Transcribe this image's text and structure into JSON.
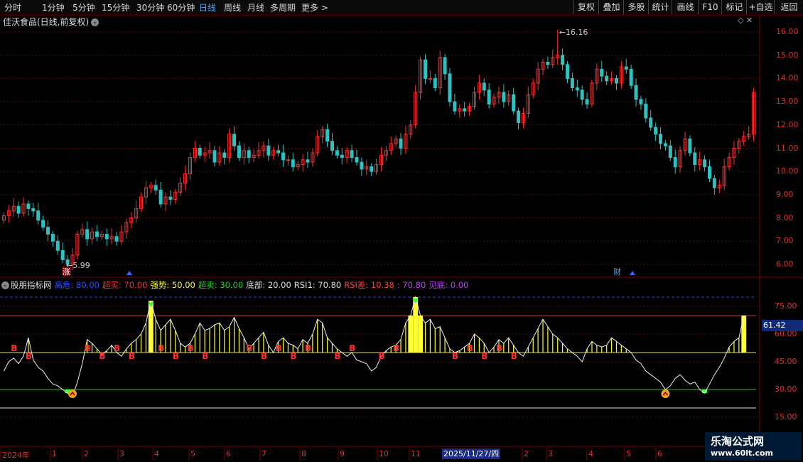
{
  "topbar": {
    "periods": [
      "分时",
      "1分钟",
      "5分钟",
      "15分钟",
      "30分钟",
      "60分钟",
      "日线",
      "周线",
      "月线",
      "多周期",
      "更多 >"
    ],
    "active_period": "日线",
    "buttons": [
      "复权",
      "叠加",
      "多股",
      "统计",
      "画线",
      "F10",
      "标记",
      "+自选",
      "返回"
    ]
  },
  "main_chart": {
    "title": "佳沃食品(日线,前复权)",
    "high_marker": "16.16",
    "low_marker": "5.99",
    "y_ticks": [
      "16.00",
      "15.00",
      "14.00",
      "13.00",
      "12.00",
      "11.00",
      "10.00",
      "9.00",
      "8.00",
      "7.00",
      "6.00"
    ],
    "event_tags": [
      "涨",
      "财"
    ]
  },
  "indicator": {
    "name": "股朋指标网",
    "params": [
      {
        "label": "高危:",
        "value": "80.00",
        "color": "#3050ff"
      },
      {
        "label": "超买:",
        "value": "70.00",
        "color": "#ff3030"
      },
      {
        "label": "强势:",
        "value": "50.00",
        "color": "#ffff40"
      },
      {
        "label": "超卖:",
        "value": "30.00",
        "color": "#30d030"
      },
      {
        "label": "底部:",
        "value": "20.00",
        "color": "#e0e0e0"
      },
      {
        "label": "RSI1:",
        "value": "70.80",
        "color": "#e0e0e0"
      },
      {
        "label": "RSI差:",
        "value": "10.38",
        "color": "#ff4040"
      },
      {
        "label": ":",
        "value": "70.80",
        "color": "#c040ff"
      },
      {
        "label": "见底:",
        "value": "0.00",
        "color": "#c040ff"
      }
    ],
    "y_ticks": [
      "75.00",
      "60.00",
      "45.00",
      "30.00",
      "15.00"
    ],
    "current_value": "61.42"
  },
  "date_axis": {
    "labels": [
      "2024年",
      "1",
      "2",
      "3",
      "4",
      "5",
      "6",
      "7",
      "8",
      "9",
      "10",
      "11",
      "2",
      "3",
      "4",
      "5",
      "6"
    ],
    "cursor_date": "2025/11/27/四"
  },
  "watermark": {
    "line1": "乐淘公式网",
    "line2": "www.60lt.com"
  },
  "chart_data": {
    "type": "candlestick",
    "y_range": [
      5.6,
      16.5
    ],
    "close": [
      8.1,
      8.3,
      8.5,
      8.2,
      8.6,
      8.4,
      8.3,
      7.9,
      7.6,
      7.3,
      7.0,
      6.6,
      6.2,
      6.0,
      6.4,
      7.3,
      7.5,
      7.1,
      7.4,
      7.2,
      7.3,
      7.1,
      7.2,
      7.0,
      7.4,
      7.8,
      8.0,
      8.4,
      8.9,
      9.3,
      9.4,
      9.2,
      8.6,
      8.9,
      8.8,
      9.1,
      9.5,
      9.9,
      10.6,
      11.0,
      10.7,
      10.8,
      10.9,
      10.4,
      10.8,
      10.6,
      11.6,
      11.1,
      10.6,
      10.9,
      10.6,
      10.7,
      10.9,
      11.1,
      10.7,
      10.9,
      10.8,
      10.5,
      10.5,
      10.2,
      10.3,
      10.5,
      10.4,
      10.8,
      11.5,
      11.8,
      11.3,
      10.9,
      10.7,
      10.6,
      10.9,
      10.6,
      10.4,
      10.1,
      10.2,
      10.0,
      10.3,
      10.7,
      10.9,
      11.2,
      11.4,
      11.0,
      11.6,
      12.0,
      13.4,
      14.8,
      14.0,
      14.0,
      13.6,
      14.9,
      14.2,
      13.0,
      12.6,
      12.7,
      12.6,
      12.8,
      13.4,
      13.8,
      13.5,
      12.9,
      13.2,
      13.4,
      13.0,
      13.3,
      12.6,
      12.1,
      12.5,
      13.3,
      13.8,
      14.4,
      14.7,
      14.6,
      14.9,
      15.0,
      14.6,
      14.0,
      13.6,
      13.5,
      13.1,
      12.9,
      13.8,
      14.4,
      14.1,
      13.9,
      14.0,
      13.8,
      14.5,
      14.4,
      13.7,
      13.1,
      12.9,
      12.3,
      11.9,
      11.6,
      11.2,
      11.1,
      10.6,
      10.2,
      10.9,
      11.4,
      10.8,
      10.3,
      10.5,
      10.2,
      9.7,
      9.3,
      9.4,
      10.2,
      10.6,
      11.0,
      11.3,
      11.5,
      11.6,
      13.4
    ],
    "indicator_levels": {
      "high_risk": 80,
      "overbought": 70,
      "strong": 50,
      "oversold": 30,
      "bottom": 20
    },
    "indicator_range": [
      5,
      88
    ],
    "rsi": [
      40,
      45,
      47,
      44,
      48,
      58,
      46,
      42,
      40,
      36,
      33,
      32,
      30,
      28,
      26,
      34,
      44,
      57,
      55,
      52,
      49,
      51,
      54,
      50,
      48,
      52,
      55,
      57,
      60,
      66,
      78,
      68,
      62,
      65,
      68,
      62,
      55,
      53,
      55,
      60,
      66,
      62,
      63,
      65,
      66,
      62,
      64,
      69,
      63,
      58,
      52,
      55,
      58,
      61,
      54,
      50,
      56,
      58,
      55,
      54,
      52,
      57,
      55,
      60,
      68,
      66,
      58,
      55,
      52,
      50,
      48,
      50,
      46,
      45,
      44,
      40,
      42,
      48,
      51,
      53,
      54,
      57,
      66,
      70,
      80,
      70,
      66,
      68,
      63,
      64,
      58,
      52,
      50,
      51,
      53,
      55,
      60,
      58,
      55,
      50,
      53,
      57,
      55,
      58,
      54,
      50,
      48,
      53,
      58,
      63,
      68,
      64,
      60,
      58,
      55,
      52,
      50,
      48,
      45,
      52,
      56,
      54,
      53,
      54,
      58,
      56,
      54,
      52,
      50,
      46,
      44,
      40,
      38,
      36,
      34,
      30,
      32,
      36,
      38,
      35,
      33,
      34,
      30,
      28,
      33,
      38,
      42,
      47,
      53,
      56,
      58,
      70
    ],
    "buy_markers": 24,
    "sell_markers": 6,
    "bottom_markers": 3
  }
}
